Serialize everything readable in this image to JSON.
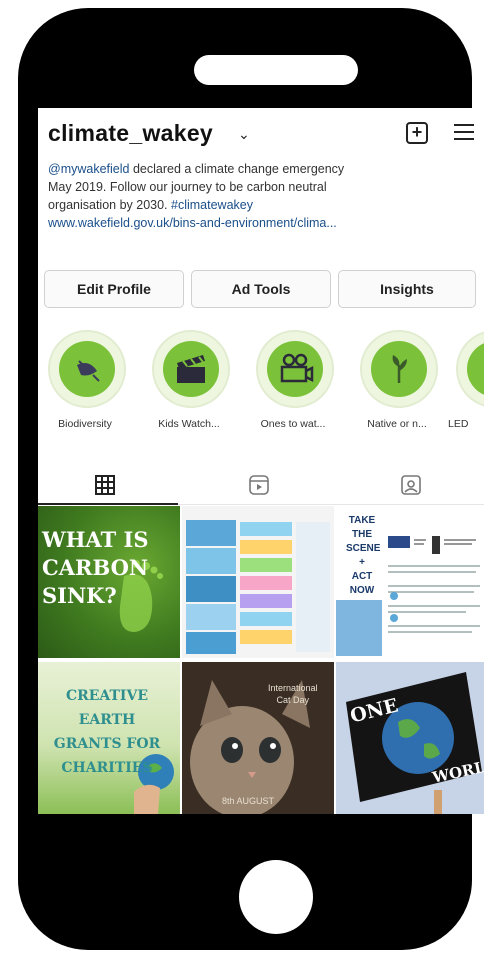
{
  "profile": {
    "username": "climate_wakey",
    "bio_lines": [
      {
        "mention": "@mywakefield",
        "text": " declared a climate change emergency"
      },
      {
        "text": "May 2019. Follow our journey to be carbon neutral"
      },
      {
        "text": "organisation by 2030. ",
        "hashtag": "#climatewakey"
      },
      {
        "url": "www.wakefield.gov.uk/bins-and-environment/clima..."
      }
    ]
  },
  "buttons": {
    "edit_profile": "Edit Profile",
    "ad_tools": "Ad Tools",
    "insights": "Insights"
  },
  "highlights": [
    {
      "label": "Biodiversity",
      "icon": "leaf-icon"
    },
    {
      "label": "Kids Watch...",
      "icon": "clapperboard-icon"
    },
    {
      "label": "Ones to wat...",
      "icon": "projector-icon"
    },
    {
      "label": "Native or n...",
      "icon": "plant-icon"
    },
    {
      "label": "LED",
      "icon": "lightbulb-icon"
    }
  ],
  "tabs": [
    {
      "name": "grid-icon",
      "active": true
    },
    {
      "name": "reels-icon",
      "active": false
    },
    {
      "name": "tagged-icon",
      "active": false
    }
  ],
  "posts": {
    "post1": {
      "lines": [
        "WHAT IS",
        "CARBON",
        "SINK?"
      ]
    },
    "post3": {
      "lines": [
        "TAKE",
        "THE",
        "SCENE",
        "+",
        "ACT",
        "NOW"
      ]
    },
    "post4": {
      "lines": [
        "CREATIVE",
        "EARTH",
        "GRANTS FOR",
        "CHARITIES"
      ]
    },
    "post5": {
      "lines": [
        "International",
        "Cat Day",
        "8th AUGUST"
      ]
    },
    "post6": {
      "lines": [
        "ONE",
        "WORLD"
      ]
    }
  },
  "colors": {
    "highlight_green": "#7cc13a",
    "link_blue": "#1a4f8a"
  }
}
